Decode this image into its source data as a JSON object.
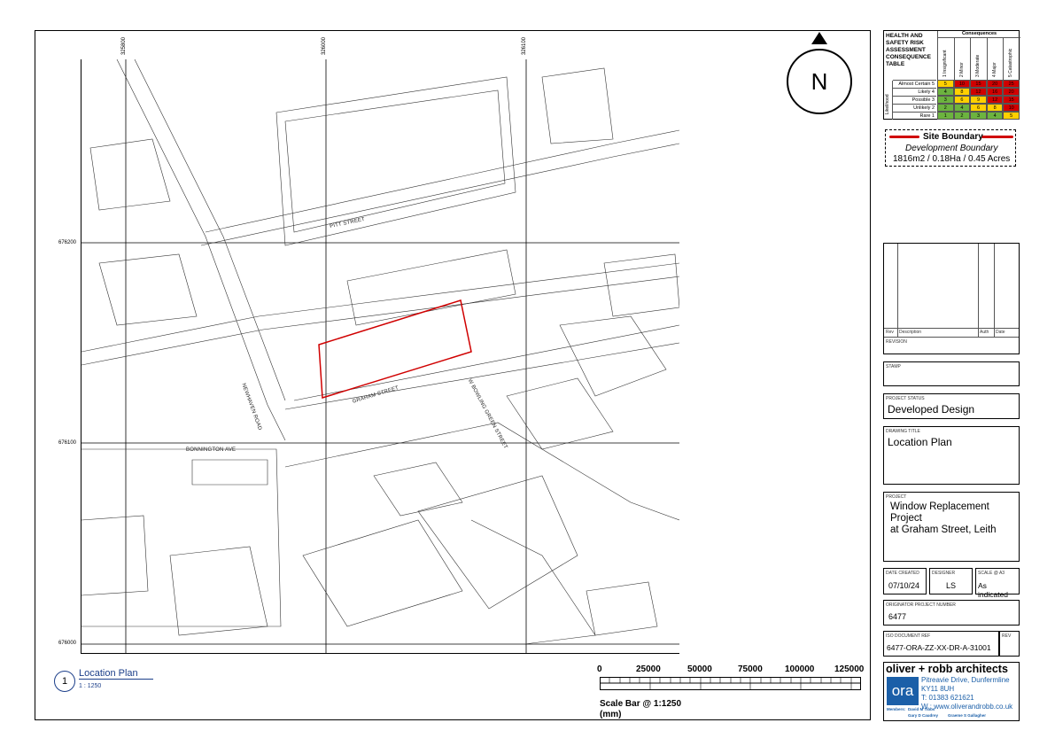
{
  "map": {
    "grid_top": [
      "325800",
      "326000",
      "326100"
    ],
    "grid_left": [
      "676200",
      "676100",
      "676000"
    ],
    "streets": {
      "pitt": "PITT STREET",
      "graham": "GRAHAM STREET",
      "newhaven": "NEWHAVEN ROAD",
      "bowling": "W BOWLING GREEN STREET",
      "bonnington": "BONNINGTON AVE"
    }
  },
  "north": {
    "label": "N"
  },
  "risk": {
    "title": "HEALTH AND SAFETY RISK ASSESSMENT CONSEQUENCE TABLE",
    "consequences_header": "Consequences",
    "consequences": [
      "1 Insignificant",
      "2 Minor",
      "3 Moderate",
      "4 Major",
      "5 Catastrophic"
    ],
    "likelihood_header": "Likelihood",
    "rows": [
      {
        "label": "Almost Certain 5",
        "values": [
          "5",
          "10",
          "15",
          "20",
          "25"
        ],
        "colors": [
          "#ffd000",
          "#d00000",
          "#d00000",
          "#d00000",
          "#d00000"
        ]
      },
      {
        "label": "Likely 4",
        "values": [
          "4",
          "8",
          "12",
          "16",
          "20"
        ],
        "colors": [
          "#6cb33f",
          "#ffd000",
          "#d00000",
          "#d00000",
          "#d00000"
        ]
      },
      {
        "label": "Possible 3",
        "values": [
          "3",
          "6",
          "9",
          "12",
          "15"
        ],
        "colors": [
          "#6cb33f",
          "#ffd000",
          "#ffd000",
          "#d00000",
          "#d00000"
        ]
      },
      {
        "label": "Unlikely 2",
        "values": [
          "2",
          "4",
          "6",
          "8",
          "10"
        ],
        "colors": [
          "#6cb33f",
          "#6cb33f",
          "#ffd000",
          "#ffd000",
          "#d00000"
        ]
      },
      {
        "label": "Rare 1",
        "values": [
          "1",
          "2",
          "3",
          "4",
          "5"
        ],
        "colors": [
          "#6cb33f",
          "#6cb33f",
          "#6cb33f",
          "#6cb33f",
          "#ffd000"
        ]
      }
    ]
  },
  "legend": {
    "site_boundary": "Site Boundary",
    "dev_boundary": "Development Boundary",
    "area": "1816m2 / 0.18Ha / 0.45 Acres",
    "line_color": "#d00000"
  },
  "revision": {
    "rev": "Rev",
    "description": "Description",
    "auth": "Auth",
    "date": "Date",
    "label": "REVISION"
  },
  "stamp": {
    "label": "STAMP"
  },
  "project_status": {
    "label": "PROJECT STATUS",
    "value": "Developed Design"
  },
  "drawing_title": {
    "label": "DRAWING TITLE",
    "value": "Location Plan"
  },
  "project": {
    "label": "PROJECT",
    "line1": "Window Replacement",
    "line2": "Project",
    "line3": "at Graham Street, Leith"
  },
  "meta": {
    "date_label": "DATE CREATED",
    "date": "07/10/24",
    "designer_label": "DESIGNER",
    "designer": "LS",
    "scale_label": "SCALE @ A3",
    "scale": "As indicated"
  },
  "originator": {
    "label": "ORIGINATOR PROJECT NUMBER",
    "value": "6477"
  },
  "iso": {
    "label": "ISO DOCUMENT REF",
    "value": "6477-ORA-ZZ-XX-DR-A-31001",
    "rev_label": "REV"
  },
  "firm": {
    "name": "oliver + robb architects",
    "logo": "ora",
    "addr1": "Pitreavie Drive, Dunfermline",
    "addr2": "KY11 8UH",
    "tel": "T: 01383 621621",
    "web": "W : www.oliverandrobb.co.uk",
    "members_label": "Members:",
    "member1": "David M Tibbs",
    "member2": "Gary D Caudrey",
    "member3": "Graeme S Gallagher",
    "brand_color": "#1b5fa8"
  },
  "caption": {
    "number": "1",
    "title": "Location Plan",
    "scale": "1 : 1250"
  },
  "scalebar": {
    "ticks": [
      "0",
      "25000",
      "50000",
      "75000",
      "100000",
      "125000"
    ],
    "label": "Scale Bar @ 1:1250",
    "unit": "(mm)"
  }
}
